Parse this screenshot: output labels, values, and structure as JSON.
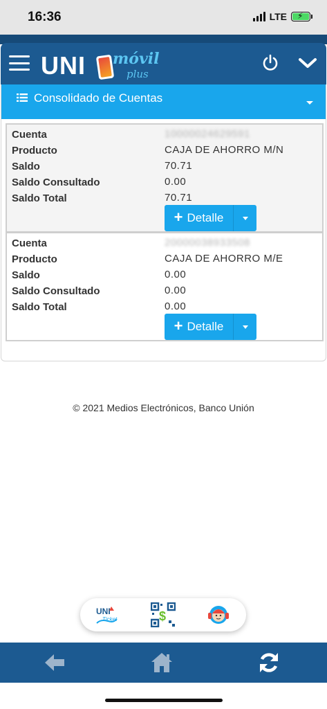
{
  "status_bar": {
    "time": "16:36",
    "network": "LTE"
  },
  "header": {
    "logo": {
      "uni": "UNI",
      "movil": "móvil",
      "plus": "plus"
    },
    "icons": {
      "menu": "hamburger-icon",
      "power": "power-icon",
      "expand": "chevron-down-icon"
    }
  },
  "panel": {
    "title": "Consolidado de Cuentas",
    "icon": "list-icon"
  },
  "accounts": [
    {
      "labels": {
        "cuenta": "Cuenta",
        "producto": "Producto",
        "saldo": "Saldo",
        "saldo_consultado": "Saldo Consultado",
        "saldo_total": "Saldo Total"
      },
      "cuenta": "10000024629591",
      "producto": "CAJA DE AHORRO M/N",
      "saldo": "70.71",
      "saldo_consultado": "0.00",
      "saldo_total": "70.71",
      "button_label": "Detalle"
    },
    {
      "labels": {
        "cuenta": "Cuenta",
        "producto": "Producto",
        "saldo": "Saldo",
        "saldo_consultado": "Saldo Consultado",
        "saldo_total": "Saldo Total"
      },
      "cuenta": "20000038933508",
      "producto": "CAJA DE AHORRO M/E",
      "saldo": "0.00",
      "saldo_consultado": "0.00",
      "saldo_total": "0.00",
      "button_label": "Detalle"
    }
  ],
  "footer": {
    "copyright": "© 2021 Medios Electrónicos, Banco Unión"
  },
  "quick_access": {
    "uniticket_logo": {
      "uni": "UNI",
      "ticket": "Ticket"
    },
    "icons": [
      "uniticket-icon",
      "qr-payment-icon",
      "support-agent-icon"
    ]
  },
  "bottom_nav": {
    "icons": [
      "arrow-left-icon",
      "home-icon",
      "refresh-icon"
    ]
  },
  "colors": {
    "header_blue": "#1c5a91",
    "accent_blue": "#19a6ec"
  }
}
